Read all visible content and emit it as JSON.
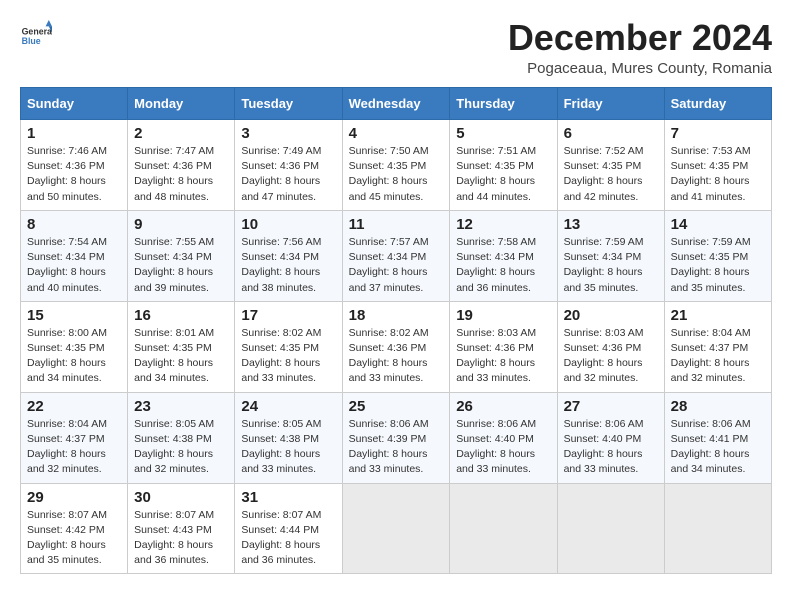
{
  "header": {
    "logo_line1": "General",
    "logo_line2": "Blue",
    "month": "December 2024",
    "location": "Pogaceaua, Mures County, Romania"
  },
  "weekdays": [
    "Sunday",
    "Monday",
    "Tuesday",
    "Wednesday",
    "Thursday",
    "Friday",
    "Saturday"
  ],
  "weeks": [
    [
      {
        "day": "1",
        "sunrise": "7:46 AM",
        "sunset": "4:36 PM",
        "daylight": "8 hours and 50 minutes."
      },
      {
        "day": "2",
        "sunrise": "7:47 AM",
        "sunset": "4:36 PM",
        "daylight": "8 hours and 48 minutes."
      },
      {
        "day": "3",
        "sunrise": "7:49 AM",
        "sunset": "4:36 PM",
        "daylight": "8 hours and 47 minutes."
      },
      {
        "day": "4",
        "sunrise": "7:50 AM",
        "sunset": "4:35 PM",
        "daylight": "8 hours and 45 minutes."
      },
      {
        "day": "5",
        "sunrise": "7:51 AM",
        "sunset": "4:35 PM",
        "daylight": "8 hours and 44 minutes."
      },
      {
        "day": "6",
        "sunrise": "7:52 AM",
        "sunset": "4:35 PM",
        "daylight": "8 hours and 42 minutes."
      },
      {
        "day": "7",
        "sunrise": "7:53 AM",
        "sunset": "4:35 PM",
        "daylight": "8 hours and 41 minutes."
      }
    ],
    [
      {
        "day": "8",
        "sunrise": "7:54 AM",
        "sunset": "4:34 PM",
        "daylight": "8 hours and 40 minutes."
      },
      {
        "day": "9",
        "sunrise": "7:55 AM",
        "sunset": "4:34 PM",
        "daylight": "8 hours and 39 minutes."
      },
      {
        "day": "10",
        "sunrise": "7:56 AM",
        "sunset": "4:34 PM",
        "daylight": "8 hours and 38 minutes."
      },
      {
        "day": "11",
        "sunrise": "7:57 AM",
        "sunset": "4:34 PM",
        "daylight": "8 hours and 37 minutes."
      },
      {
        "day": "12",
        "sunrise": "7:58 AM",
        "sunset": "4:34 PM",
        "daylight": "8 hours and 36 minutes."
      },
      {
        "day": "13",
        "sunrise": "7:59 AM",
        "sunset": "4:34 PM",
        "daylight": "8 hours and 35 minutes."
      },
      {
        "day": "14",
        "sunrise": "7:59 AM",
        "sunset": "4:35 PM",
        "daylight": "8 hours and 35 minutes."
      }
    ],
    [
      {
        "day": "15",
        "sunrise": "8:00 AM",
        "sunset": "4:35 PM",
        "daylight": "8 hours and 34 minutes."
      },
      {
        "day": "16",
        "sunrise": "8:01 AM",
        "sunset": "4:35 PM",
        "daylight": "8 hours and 34 minutes."
      },
      {
        "day": "17",
        "sunrise": "8:02 AM",
        "sunset": "4:35 PM",
        "daylight": "8 hours and 33 minutes."
      },
      {
        "day": "18",
        "sunrise": "8:02 AM",
        "sunset": "4:36 PM",
        "daylight": "8 hours and 33 minutes."
      },
      {
        "day": "19",
        "sunrise": "8:03 AM",
        "sunset": "4:36 PM",
        "daylight": "8 hours and 33 minutes."
      },
      {
        "day": "20",
        "sunrise": "8:03 AM",
        "sunset": "4:36 PM",
        "daylight": "8 hours and 32 minutes."
      },
      {
        "day": "21",
        "sunrise": "8:04 AM",
        "sunset": "4:37 PM",
        "daylight": "8 hours and 32 minutes."
      }
    ],
    [
      {
        "day": "22",
        "sunrise": "8:04 AM",
        "sunset": "4:37 PM",
        "daylight": "8 hours and 32 minutes."
      },
      {
        "day": "23",
        "sunrise": "8:05 AM",
        "sunset": "4:38 PM",
        "daylight": "8 hours and 32 minutes."
      },
      {
        "day": "24",
        "sunrise": "8:05 AM",
        "sunset": "4:38 PM",
        "daylight": "8 hours and 33 minutes."
      },
      {
        "day": "25",
        "sunrise": "8:06 AM",
        "sunset": "4:39 PM",
        "daylight": "8 hours and 33 minutes."
      },
      {
        "day": "26",
        "sunrise": "8:06 AM",
        "sunset": "4:40 PM",
        "daylight": "8 hours and 33 minutes."
      },
      {
        "day": "27",
        "sunrise": "8:06 AM",
        "sunset": "4:40 PM",
        "daylight": "8 hours and 33 minutes."
      },
      {
        "day": "28",
        "sunrise": "8:06 AM",
        "sunset": "4:41 PM",
        "daylight": "8 hours and 34 minutes."
      }
    ],
    [
      {
        "day": "29",
        "sunrise": "8:07 AM",
        "sunset": "4:42 PM",
        "daylight": "8 hours and 35 minutes."
      },
      {
        "day": "30",
        "sunrise": "8:07 AM",
        "sunset": "4:43 PM",
        "daylight": "8 hours and 36 minutes."
      },
      {
        "day": "31",
        "sunrise": "8:07 AM",
        "sunset": "4:44 PM",
        "daylight": "8 hours and 36 minutes."
      },
      null,
      null,
      null,
      null
    ]
  ],
  "labels": {
    "sunrise": "Sunrise:",
    "sunset": "Sunset:",
    "daylight": "Daylight:"
  }
}
